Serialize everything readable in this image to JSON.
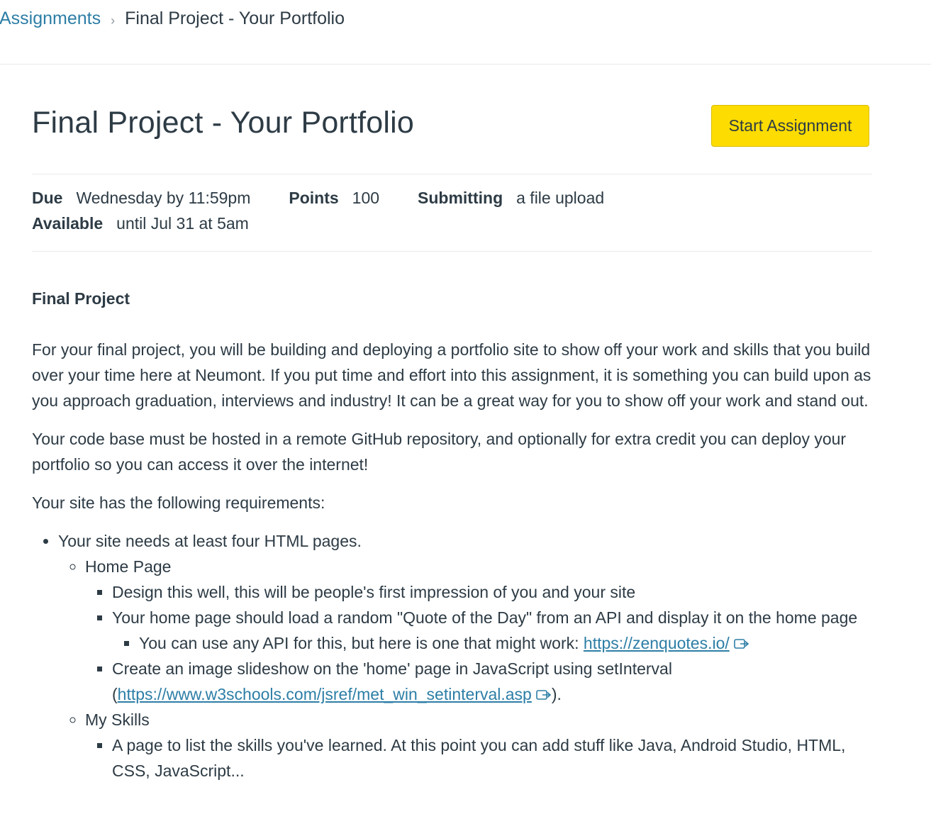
{
  "breadcrumb": {
    "parent": "Assignments",
    "separator": "›",
    "current": "Final Project - Your Portfolio"
  },
  "header": {
    "title": "Final Project - Your Portfolio",
    "start_button": "Start Assignment"
  },
  "details": {
    "due_label": "Due",
    "due_value": "Wednesday by 11:59pm",
    "points_label": "Points",
    "points_value": "100",
    "submitting_label": "Submitting",
    "submitting_value": "a file upload",
    "available_label": "Available",
    "available_value": "until Jul 31 at 5am"
  },
  "description": {
    "heading": "Final Project",
    "p1": "For your final project, you will be building and deploying a portfolio site to show off your work and skills that you build over your time here at Neumont. If you put time and effort into this assignment, it is something you can build upon as you approach graduation, interviews and industry! It can be a great way for you to show off your work and stand out.",
    "p2": "Your code base must be hosted in a remote GitHub repository, and optionally for extra credit you can deploy your portfolio so you can access it over the internet!",
    "p3": "Your site has the following requirements:",
    "req1": "Your site needs at least four HTML pages.",
    "home_page": "Home Page",
    "home_design": "Design this well, this will be people's first impression of you and your site",
    "home_quote": "Your home page should load a random \"Quote of the Day\" from an API and display it on the home page",
    "api_note": "You can use any API for this, but here is one that might work: ",
    "api_link": "https://zenquotes.io/",
    "slideshow_text": "Create an image slideshow on the 'home' page in JavaScript using setInterval (",
    "slideshow_link": "https://www.w3schools.com/jsref/met_win_setinterval.asp",
    "slideshow_end": ").",
    "my_skills": "My Skills",
    "skills_text": "A page to list the skills you've learned. At this point you can add stuff like Java, Android Studio, HTML, CSS, JavaScript..."
  },
  "colors": {
    "link": "#2d7ea6",
    "text": "#2d3b45",
    "button": "#fddc01"
  }
}
